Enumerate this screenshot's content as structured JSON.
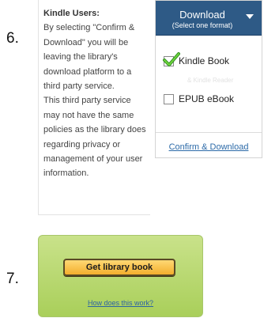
{
  "steps": {
    "six": "6.",
    "seven": "7."
  },
  "info": {
    "heading": "Kindle Users:",
    "lines": [
      "By selecting \"Confirm &",
      "Download\" you will be",
      "leaving the library's",
      "download platform to a",
      "third party service.",
      "This third party service",
      "may not have the same",
      "policies as the library does",
      "regarding privacy or",
      "management of your user",
      "information."
    ]
  },
  "download": {
    "title": "Download",
    "subtitle": "(Select one format)",
    "options": [
      {
        "label": "Kindle Book",
        "checked": true
      },
      {
        "label": "EPUB eBook",
        "checked": false
      }
    ],
    "ghost_text": "& Kindle Reader",
    "confirm": "Confirm & Download"
  },
  "library": {
    "button": "Get library book",
    "how_link": "How does this work?"
  }
}
